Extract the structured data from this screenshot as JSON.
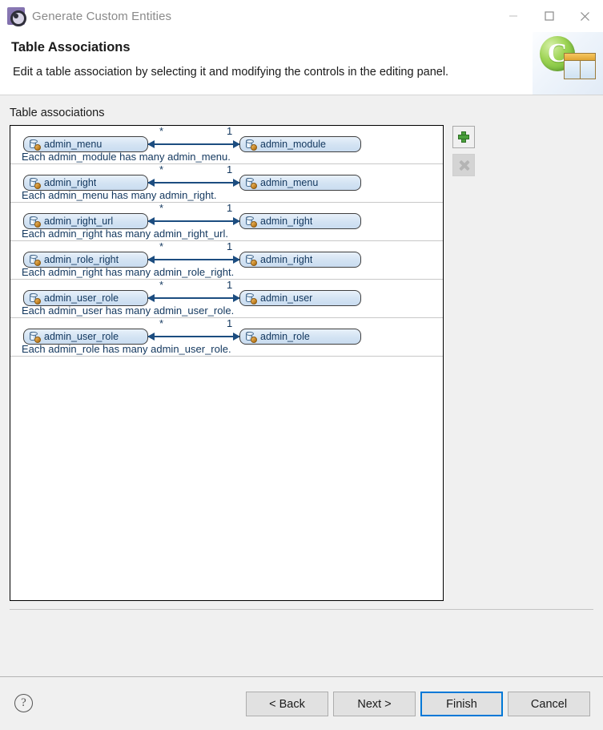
{
  "window": {
    "title": "Generate Custom Entities",
    "icon": "gear-icon",
    "controls": {
      "minimize": "minimize-icon",
      "maximize": "maximize-icon",
      "close": "close-icon"
    }
  },
  "header": {
    "title": "Table Associations",
    "description": "Edit a table association by selecting it and modifying the controls in the editing panel.",
    "art_letter": "C"
  },
  "main": {
    "group_label": "Table associations",
    "associations": [
      {
        "left_entity": "admin_menu",
        "right_entity": "admin_module",
        "left_cardinality": "*",
        "right_cardinality": "1",
        "description": "Each admin_module has many admin_menu."
      },
      {
        "left_entity": "admin_right",
        "right_entity": "admin_menu",
        "left_cardinality": "*",
        "right_cardinality": "1",
        "description": "Each admin_menu has many admin_right."
      },
      {
        "left_entity": "admin_right_url",
        "right_entity": "admin_right",
        "left_cardinality": "*",
        "right_cardinality": "1",
        "description": "Each admin_right has many admin_right_url."
      },
      {
        "left_entity": "admin_role_right",
        "right_entity": "admin_right",
        "left_cardinality": "*",
        "right_cardinality": "1",
        "description": "Each admin_right has many admin_role_right."
      },
      {
        "left_entity": "admin_user_role",
        "right_entity": "admin_user",
        "left_cardinality": "*",
        "right_cardinality": "1",
        "description": "Each admin_user has many admin_user_role."
      },
      {
        "left_entity": "admin_user_role",
        "right_entity": "admin_role",
        "left_cardinality": "*",
        "right_cardinality": "1",
        "description": "Each admin_role has many admin_user_role."
      }
    ],
    "side_buttons": [
      {
        "name": "add-association-button",
        "icon": "plus-icon",
        "enabled": true
      },
      {
        "name": "remove-association-button",
        "icon": "x-icon",
        "enabled": false
      }
    ]
  },
  "footer": {
    "help": "?",
    "buttons": [
      {
        "label": "< Back",
        "name": "back-button",
        "default": false
      },
      {
        "label": "Next >",
        "name": "next-button",
        "default": false
      },
      {
        "label": "Finish",
        "name": "finish-button",
        "default": true
      },
      {
        "label": "Cancel",
        "name": "cancel-button",
        "default": false
      }
    ]
  },
  "colors": {
    "accent": "#0078d7",
    "entity_text": "#12375e",
    "arrow": "#1c4d80",
    "panel_bg": "#f0f0f0"
  }
}
